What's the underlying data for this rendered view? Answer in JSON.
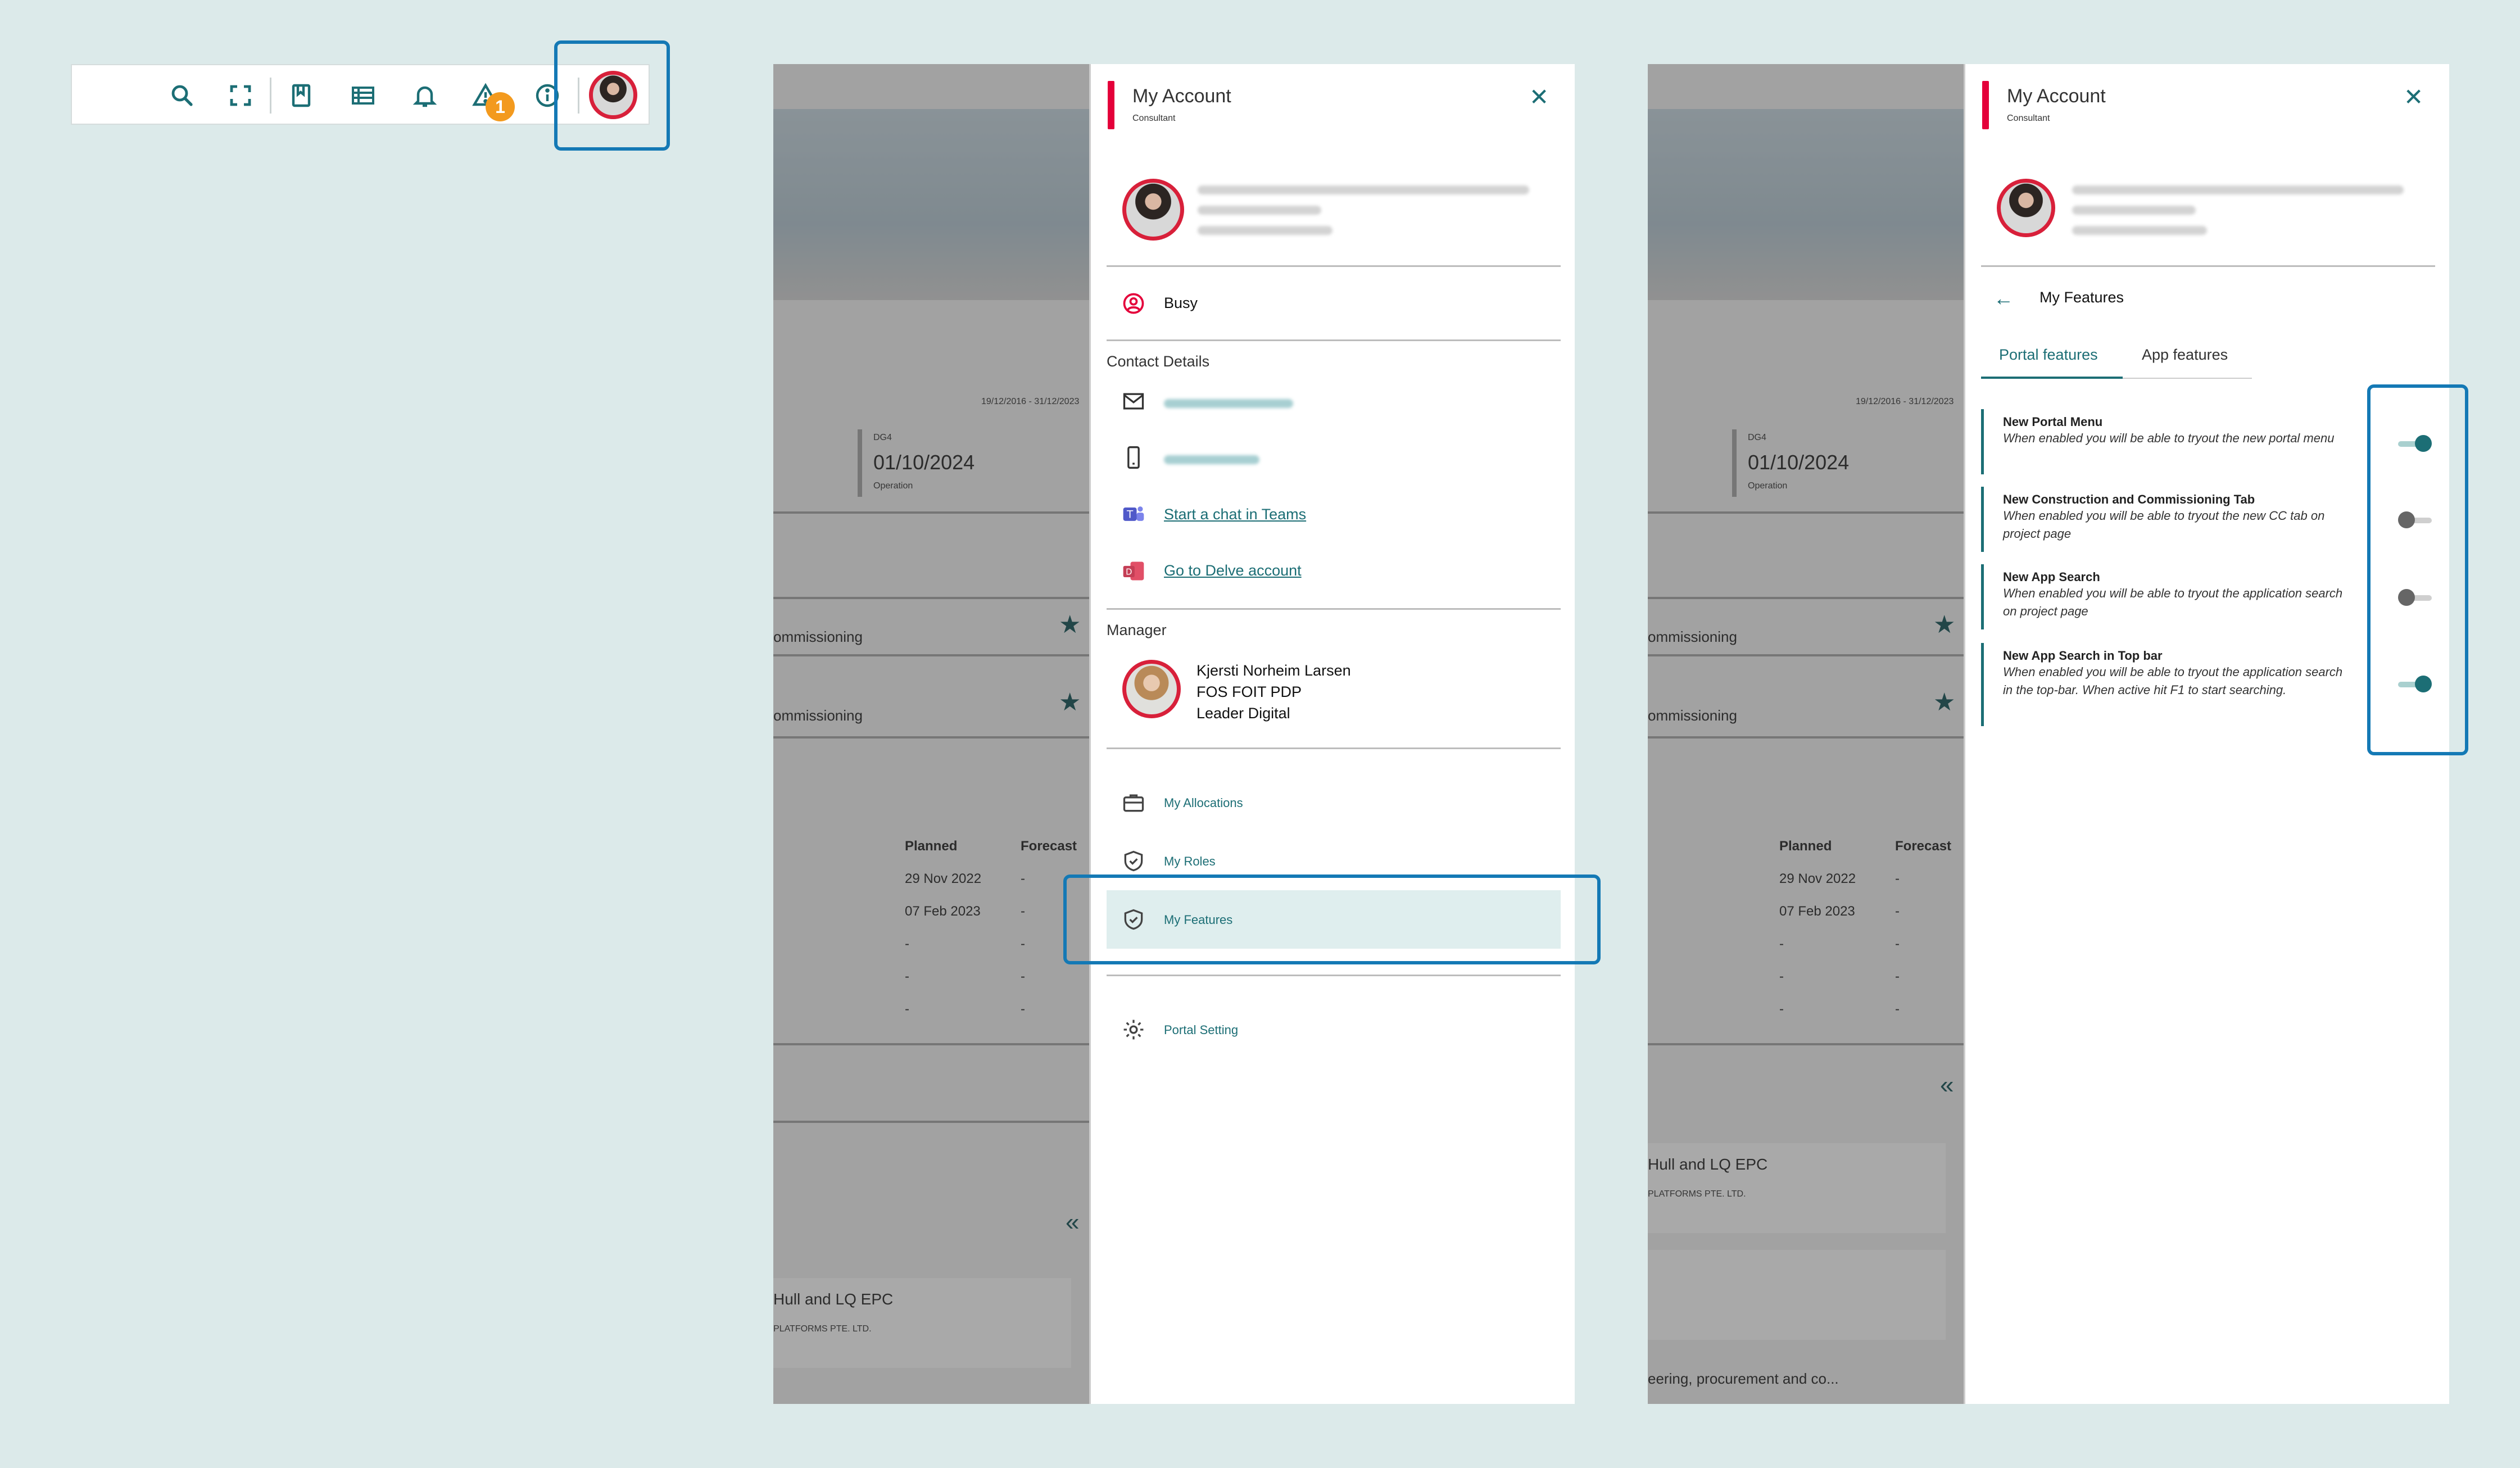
{
  "toolbar": {
    "icons": [
      "search-icon",
      "fullscreen-icon",
      "bookmark-icon",
      "list-icon",
      "bell-icon",
      "warning-icon",
      "info-icon"
    ],
    "warning_count": "1"
  },
  "background": {
    "date_range": "19/12/2016 - 31/12/2023",
    "milestone_code": "DG4",
    "milestone_date": "01/10/2024",
    "milestone_label": "Operation",
    "row1": "ommissioning",
    "row2": "ommissioning",
    "col_planned": "Planned",
    "col_forecast": "Forecast",
    "planned": [
      "29 Nov 2022",
      "07 Feb 2023",
      "-",
      "-",
      "-"
    ],
    "forecast": [
      "-",
      "-",
      "-",
      "-",
      "-"
    ],
    "project_title": "Hull and LQ EPC",
    "project_company": "PLATFORMS PTE. LTD.",
    "project_title2": "eering, procurement and co..."
  },
  "account": {
    "title": "My Account",
    "role": "Consultant",
    "status": "Busy",
    "contact_heading": "Contact Details",
    "teams_link": "Start a chat in Teams",
    "delve_link": "Go to Delve account",
    "manager_heading": "Manager",
    "manager_name": "Kjersti Norheim Larsen",
    "manager_dept": "FOS FOIT PDP",
    "manager_title": "Leader Digital",
    "menu": {
      "allocations": "My Allocations",
      "roles": "My Roles",
      "features": "My Features",
      "settings": "Portal Setting"
    }
  },
  "features": {
    "back_title": "My Features",
    "tab_portal": "Portal features",
    "tab_app": "App features",
    "items": [
      {
        "title": "New Portal Menu",
        "desc": "When enabled you will be able to tryout the new portal menu",
        "enabled": true
      },
      {
        "title": "New Construction and Commissioning Tab",
        "desc": "When enabled you will be able to tryout the new CC tab on project page",
        "enabled": false
      },
      {
        "title": "New App Search",
        "desc": "When enabled you will be able to tryout the application search on project page",
        "enabled": false
      },
      {
        "title": "New App Search in Top bar",
        "desc": "When enabled you will be able to tryout the application search in the top-bar. When active hit F1 to start searching.",
        "enabled": true
      }
    ]
  },
  "colors": {
    "accent": "#1c6e75",
    "brand_red": "#e4003a",
    "highlight": "#1479b5",
    "badge": "#f39a1e"
  }
}
